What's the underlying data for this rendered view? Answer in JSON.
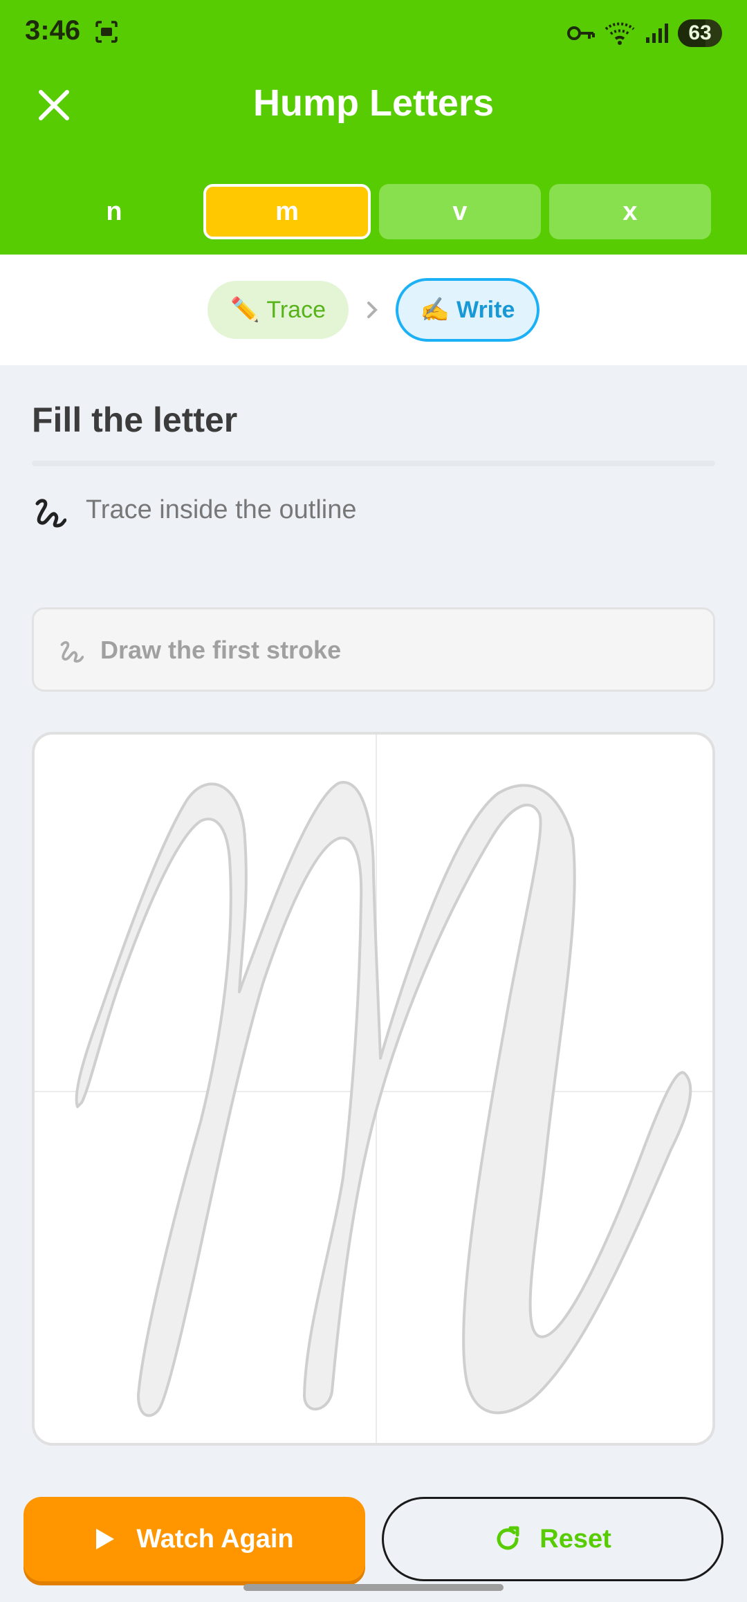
{
  "status_bar": {
    "time": "3:46",
    "battery": "63",
    "icons": [
      "screenshot-icon",
      "vpn-key-icon",
      "wifi-icon",
      "signal-icon",
      "battery-icon"
    ]
  },
  "header": {
    "title": "Hump Letters",
    "close_icon": "close-icon",
    "tabs": [
      {
        "label": "n",
        "state": "plain"
      },
      {
        "label": "m",
        "state": "active"
      },
      {
        "label": "v",
        "state": "soft"
      },
      {
        "label": "x",
        "state": "soft"
      }
    ]
  },
  "modes": {
    "trace_emoji": "✏️",
    "trace_label": "Trace",
    "separator": "›",
    "write_emoji": "✍️",
    "write_label": "Write"
  },
  "main": {
    "title": "Fill the letter",
    "instruction": "Trace inside the outline",
    "hint": "Draw the first stroke",
    "letter": "m"
  },
  "actions": {
    "watch_label": "Watch Again",
    "reset_label": "Reset"
  },
  "colors": {
    "brand_green": "#58cc02",
    "active_tab": "#ffc800",
    "soft_tab": "#89e04e",
    "write_blue": "#1cb0f6",
    "watch_orange": "#ff9600",
    "background": "#eef1f6"
  }
}
